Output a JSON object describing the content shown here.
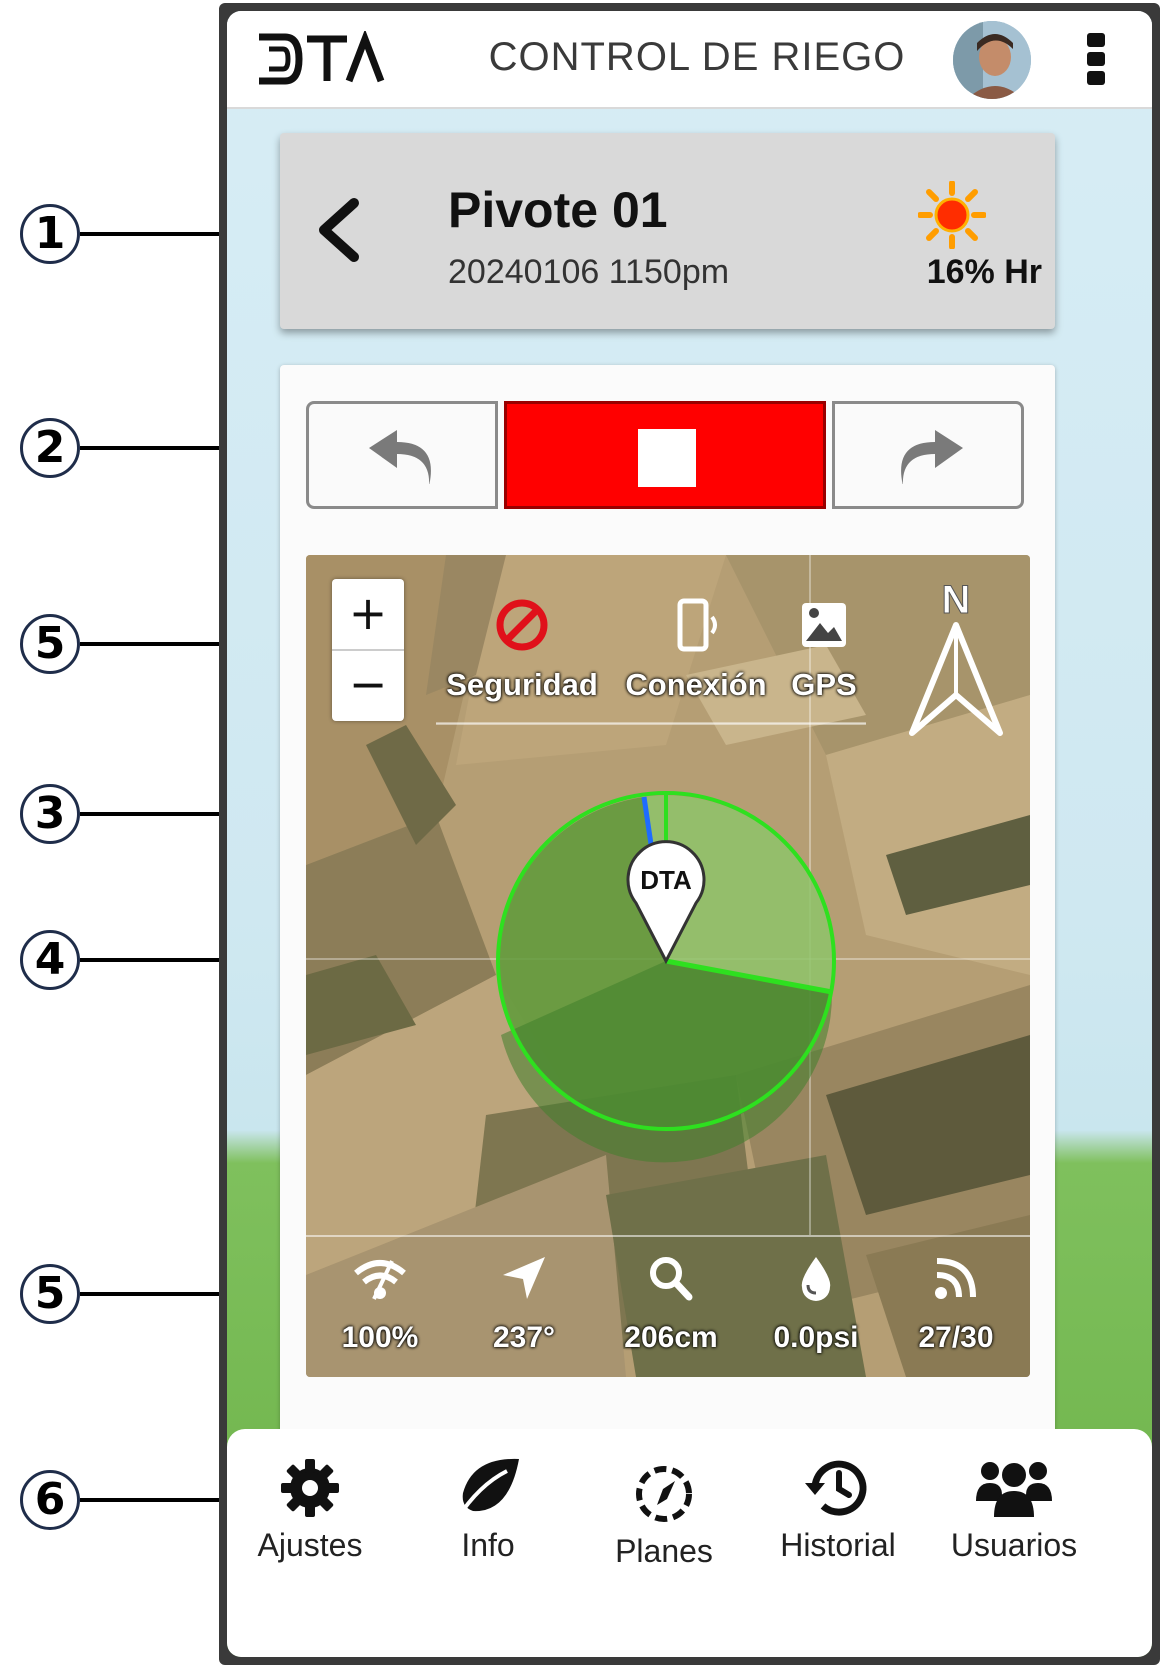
{
  "annotations": [
    "1",
    "2",
    "5",
    "3",
    "4",
    "5",
    "6"
  ],
  "header": {
    "logo": "DTA",
    "title": "CONTROL DE RIEGO",
    "avatar_icon": "user-avatar",
    "menu_icon": "more-vert-icon"
  },
  "pivot": {
    "name": "Pivote 01",
    "datetime": "20240106 1150pm",
    "weather_icon": "sun-icon",
    "humidity": "16% Hr"
  },
  "controls": {
    "reverse_icon": "undo-arrow-icon",
    "stop_icon": "stop-icon",
    "forward_icon": "redo-arrow-icon",
    "stop_color": "#ff0000"
  },
  "map": {
    "zoom_in": "+",
    "zoom_out": "−",
    "north": "N",
    "marker": "DTA",
    "status": [
      {
        "label": "Seguridad",
        "icon": "prohibited-icon"
      },
      {
        "label": "Conexión",
        "icon": "phone-signal-icon"
      },
      {
        "label": "GPS",
        "icon": "image-icon"
      }
    ],
    "readings": [
      {
        "value": "100%",
        "icon": "wifi-icon"
      },
      {
        "value": "237°",
        "icon": "navigation-arrow-icon"
      },
      {
        "value": "206cm",
        "icon": "search-icon"
      },
      {
        "value": "0.0psi",
        "icon": "water-drop-icon"
      },
      {
        "value": "27/30",
        "icon": "rss-icon"
      }
    ]
  },
  "nav": [
    {
      "label": "Ajustes",
      "icon": "gear-icon"
    },
    {
      "label": "Info",
      "icon": "leaf-icon"
    },
    {
      "label": "Planes",
      "icon": "dashed-compass-icon"
    },
    {
      "label": "Historial",
      "icon": "history-icon"
    },
    {
      "label": "Usuarios",
      "icon": "users-icon"
    }
  ]
}
